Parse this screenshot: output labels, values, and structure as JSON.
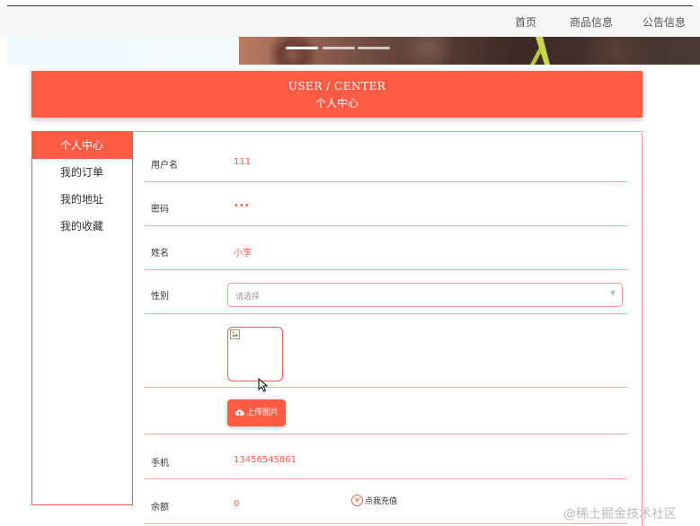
{
  "nav": {
    "items": [
      {
        "label": "首页"
      },
      {
        "label": "商品信息"
      },
      {
        "label": "公告信息"
      }
    ]
  },
  "banner": {
    "carousel_dots": 3
  },
  "header": {
    "title_en": "USER / CENTER",
    "title_cn": "个人中心"
  },
  "sidebar": {
    "items": [
      {
        "label": "个人中心",
        "active": true
      },
      {
        "label": "我的订单",
        "active": false
      },
      {
        "label": "我的地址",
        "active": false
      },
      {
        "label": "我的收藏",
        "active": false
      }
    ]
  },
  "form": {
    "username_label": "用户名",
    "username_value": "111",
    "password_label": "密码",
    "password_value": "•••",
    "name_label": "姓名",
    "name_value": "小李",
    "gender_label": "性别",
    "gender_placeholder": "请选择",
    "upload_button": "上传图片",
    "phone_label": "手机",
    "phone_value": "13456545861",
    "balance_label": "余额",
    "balance_value": "0",
    "recharge_label": "点我充值"
  },
  "colors": {
    "accent": "#fe5b45",
    "border_light": "#fcaca2"
  },
  "watermark": "@稀土掘金技术社区"
}
